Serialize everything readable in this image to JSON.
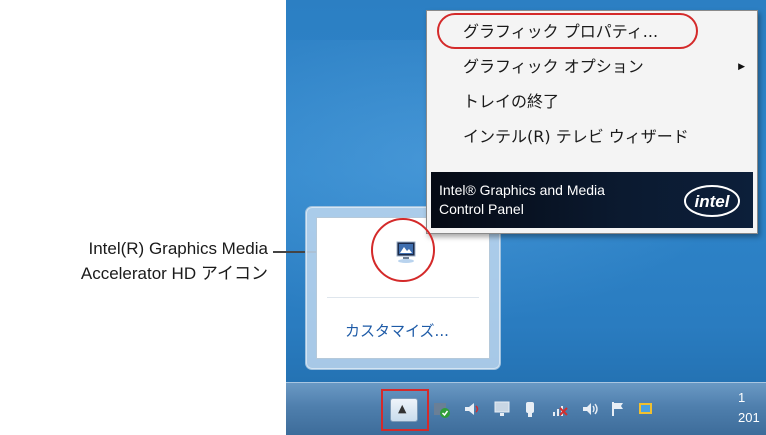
{
  "context_menu": {
    "items": [
      {
        "label": "グラフィック プロパティ...",
        "has_submenu": false
      },
      {
        "label": "グラフィック オプション",
        "has_submenu": true
      },
      {
        "label": "トレイの終了",
        "has_submenu": false
      },
      {
        "label": "インテル(R) テレビ ウィザード",
        "has_submenu": false
      }
    ],
    "banner_line1": "Intel® Graphics and Media",
    "banner_line2": "Control Panel",
    "logo_text": "intel"
  },
  "overflow_panel": {
    "customize_label": "カスタマイズ..."
  },
  "callout": {
    "line1": "Intel(R) Graphics Media",
    "line2": "Accelerator HD アイコン"
  },
  "taskbar": {
    "show_hidden_glyph": "▲",
    "clock_line1": "1",
    "clock_line2": "201"
  },
  "colors": {
    "highlight": "#d42a2a",
    "desktop_blue": "#2c7fc3",
    "link_blue": "#1e5ba7"
  }
}
